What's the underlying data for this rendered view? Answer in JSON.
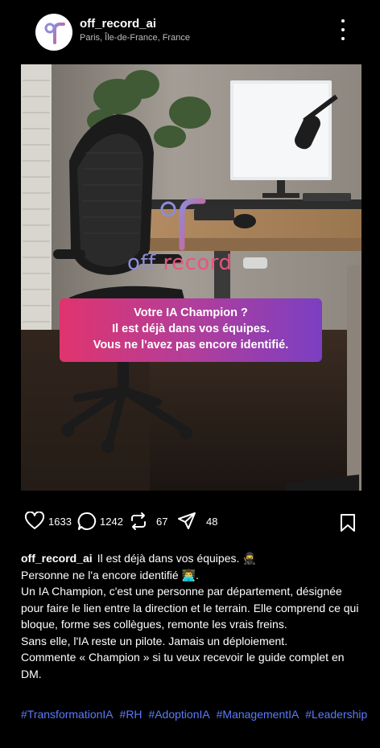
{
  "header": {
    "username": "off_record_ai",
    "location": "Paris, Île-de-France, France"
  },
  "post": {
    "logo": {
      "part1": "off ",
      "part2": "record"
    },
    "banner_lines": [
      "Votre IA Champion ?",
      "Il est déjà dans vos équipes.",
      "Vous ne l'avez pas encore identifié."
    ]
  },
  "actions": {
    "likes": "1633",
    "comments": "1242",
    "reposts": "67",
    "shares": "48"
  },
  "caption": {
    "username": "off_record_ai",
    "lines": [
      "Il est déjà dans vos équipes. 🥷",
      "Personne ne l'a encore identifié 👨‍💻.",
      "Un IA Champion, c'est une personne par département, désignée pour faire le lien entre la direction et le terrain. Elle comprend ce qui bloque, forme ses collègues, remonte les vrais freins.",
      "Sans elle, l'IA reste un pilote. Jamais un déploiement.",
      "Commente « Champion » si tu veux recevoir le guide complet en DM."
    ],
    "hashtags": [
      "#TransformationIA",
      "#RH",
      "#AdoptionIA",
      "#ManagementIA",
      "#Leadership"
    ]
  },
  "colors": {
    "hashtag": "#5b7bff",
    "banner_start": "#e0346e",
    "banner_end": "#7b3fc2",
    "logo_pink": "#e7557f",
    "logo_violet": "#8f8bd8"
  },
  "icons": [
    "off-record-logo-icon",
    "more-options-icon",
    "heart-icon",
    "comment-icon",
    "repost-icon",
    "share-icon",
    "bookmark-icon"
  ]
}
